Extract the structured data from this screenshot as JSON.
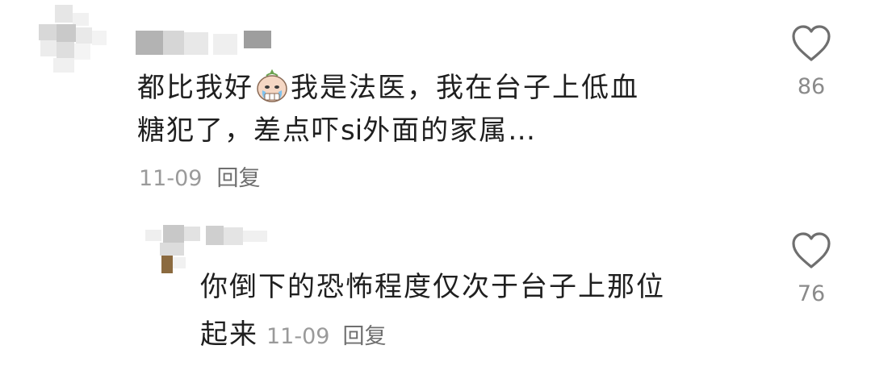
{
  "comments": [
    {
      "text_part1": "都比我好",
      "emoji": "crying-face-emoji",
      "text_part2": "我是法医，我在台子上低血",
      "text_line2_part1": "糖犯了，差点吓",
      "text_line2_latin": "si",
      "text_line2_part2": "外面的家属…",
      "date": "11-09",
      "reply_label": "回复",
      "like_icon": "heart-outline-icon",
      "like_count": "86"
    },
    {
      "text_line1": "你倒下的恐怖程度仅次于台子上那位",
      "text_line2": "起来",
      "date": "11-09",
      "reply_label": "回复",
      "like_icon": "heart-outline-icon",
      "like_count": "76"
    }
  ],
  "colors": {
    "text": "#1f1f1f",
    "meta": "#9a9a9a",
    "reply": "#6f6f6f",
    "heart": "#6f6f6f"
  }
}
